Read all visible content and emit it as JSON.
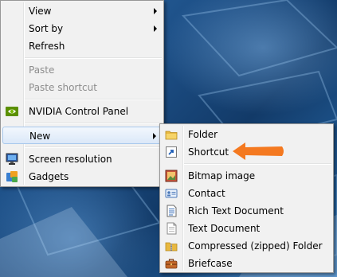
{
  "context_menu": {
    "items": [
      {
        "label": "View"
      },
      {
        "label": "Sort by"
      },
      {
        "label": "Refresh"
      },
      {
        "label": "Paste"
      },
      {
        "label": "Paste shortcut"
      },
      {
        "label": "NVIDIA Control Panel"
      },
      {
        "label": "New"
      },
      {
        "label": "Screen resolution"
      },
      {
        "label": "Gadgets"
      }
    ]
  },
  "new_submenu": {
    "items": [
      {
        "label": "Folder"
      },
      {
        "label": "Shortcut"
      },
      {
        "label": "Bitmap image"
      },
      {
        "label": "Contact"
      },
      {
        "label": "Rich Text Document"
      },
      {
        "label": "Text Document"
      },
      {
        "label": "Compressed (zipped) Folder"
      },
      {
        "label": "Briefcase"
      }
    ]
  },
  "colors": {
    "menu_background": "#f1f1f1",
    "highlight": "#dbe8f8",
    "annotation_arrow": "#f47920"
  }
}
